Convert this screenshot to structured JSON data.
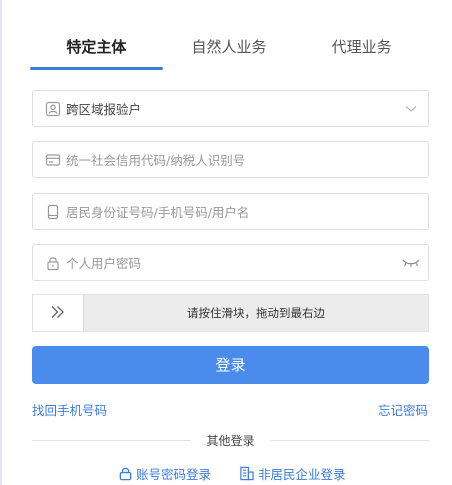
{
  "tabs": [
    {
      "label": "特定主体",
      "active": true
    },
    {
      "label": "自然人业务",
      "active": false
    },
    {
      "label": "代理业务",
      "active": false
    }
  ],
  "form": {
    "user_type": {
      "value": "跨区域报验户",
      "icon": "user-icon",
      "suffix_icon": "chevron-down-icon"
    },
    "credit_code": {
      "placeholder": "统一社会信用代码/纳税人识别号",
      "icon": "id-card-icon"
    },
    "account": {
      "placeholder": "居民身份证号码/手机号码/用户名",
      "icon": "phone-icon"
    },
    "password": {
      "placeholder": "个人用户密码",
      "icon": "lock-icon",
      "suffix_icon": "eye-closed-icon"
    }
  },
  "slider": {
    "hint": "请按住滑块，拖动到最右边",
    "handle_icon": "double-chevron-right-icon"
  },
  "login_button": "登录",
  "links": {
    "recover_phone": "找回手机号码",
    "forgot_password": "忘记密码"
  },
  "other_login": {
    "label": "其他登录",
    "options": [
      {
        "label": "账号密码登录",
        "icon": "lock-icon"
      },
      {
        "label": "非居民企业登录",
        "icon": "building-icon"
      }
    ]
  },
  "colors": {
    "accent": "#3b7ddd",
    "button": "#4a8bec",
    "border": "#dcdfe6",
    "placeholder": "#999999"
  }
}
